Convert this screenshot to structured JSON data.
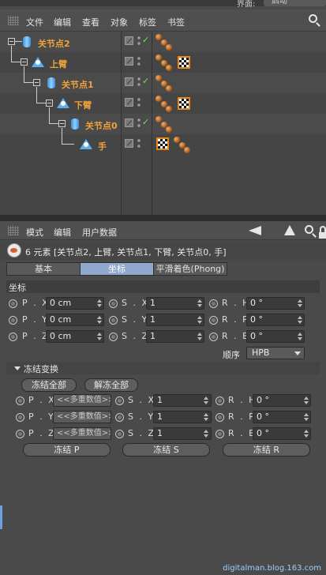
{
  "top": {
    "layout_label": "界面:",
    "layout_value": "启动"
  },
  "object_manager": {
    "menu": [
      "文件",
      "编辑",
      "查看",
      "对象",
      "标签",
      "书签"
    ],
    "objects": [
      {
        "name": "关节点2",
        "type": "null-cylinder",
        "check": "✓",
        "tags": [
          "ball"
        ]
      },
      {
        "name": "上臂",
        "type": "joint",
        "check": "",
        "tags": [
          "ball",
          "texture"
        ]
      },
      {
        "name": "关节点1",
        "type": "null-cylinder",
        "check": "✓",
        "tags": [
          "ball"
        ]
      },
      {
        "name": "下臂",
        "type": "joint",
        "check": "",
        "tags": [
          "ball",
          "texture"
        ]
      },
      {
        "name": "关节点0",
        "type": "null-cylinder",
        "check": "✓",
        "tags": [
          "ball"
        ]
      },
      {
        "name": "手",
        "type": "joint",
        "check": "",
        "tags": [
          "texture",
          "ball"
        ]
      }
    ]
  },
  "attribute_manager": {
    "menu": [
      "模式",
      "编辑",
      "用户数据"
    ],
    "selection_text": "6 元素 [关节点2, 上臂, 关节点1, 下臂, 关节点0, 手]",
    "tabs": [
      {
        "label": "基本",
        "active": false
      },
      {
        "label": "坐标",
        "active": true
      },
      {
        "label": "平滑着色(Phong)",
        "active": false
      }
    ],
    "coords_title": "坐标",
    "coords": {
      "position": [
        {
          "label": "P . X",
          "value": "0 cm"
        },
        {
          "label": "P . Y",
          "value": "0 cm"
        },
        {
          "label": "P . Z",
          "value": "0 cm"
        }
      ],
      "scale": [
        {
          "label": "S . X",
          "value": "1"
        },
        {
          "label": "S . Y",
          "value": "1"
        },
        {
          "label": "S . Z",
          "value": "1"
        }
      ],
      "rotation": [
        {
          "label": "R . H",
          "value": "0 °"
        },
        {
          "label": "R . P",
          "value": "0 °"
        },
        {
          "label": "R . B",
          "value": "0 °"
        }
      ]
    },
    "order_label": "顺序",
    "order_value": "HPB",
    "freeze": {
      "title": "冻结变换",
      "freeze_all": "冻结全部",
      "unfreeze_all": "解冻全部",
      "position": [
        {
          "label": "P . X",
          "value": "<<多重数值>>"
        },
        {
          "label": "P . Y",
          "value": "<<多重数值>>"
        },
        {
          "label": "P . Z",
          "value": "<<多重数值>>"
        }
      ],
      "scale": [
        {
          "label": "S . X",
          "value": "1"
        },
        {
          "label": "S . Y",
          "value": "1"
        },
        {
          "label": "S . Z",
          "value": "1"
        }
      ],
      "rotation": [
        {
          "label": "R . H",
          "value": "0 °"
        },
        {
          "label": "R . P",
          "value": "0 °"
        },
        {
          "label": "R . B",
          "value": "0 °"
        }
      ],
      "buttons": [
        "冻结 P",
        "冻结 S",
        "冻结 R"
      ]
    }
  },
  "watermark": "digitalman.blog.163.com"
}
